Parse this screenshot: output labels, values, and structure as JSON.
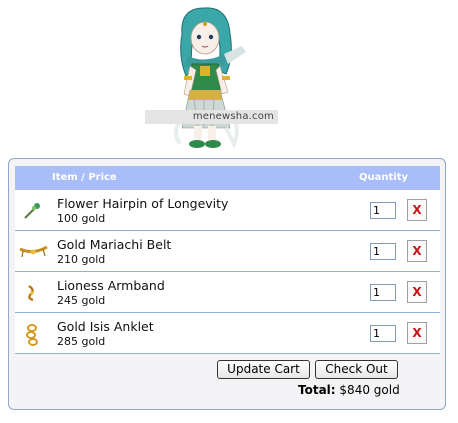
{
  "watermark": "menewsha.com",
  "cart": {
    "header": {
      "item_price": "Item / Price",
      "quantity": "Quantity"
    },
    "items": [
      {
        "name": "Flower Hairpin of Longevity",
        "price": "100 gold",
        "quantity": "1",
        "remove": "X",
        "icon": "flower-hairpin-icon"
      },
      {
        "name": "Gold Mariachi Belt",
        "price": "210 gold",
        "quantity": "1",
        "remove": "X",
        "icon": "belt-icon"
      },
      {
        "name": "Lioness Armband",
        "price": "245 gold",
        "quantity": "1",
        "remove": "X",
        "icon": "armband-icon"
      },
      {
        "name": "Gold Isis Anklet",
        "price": "285 gold",
        "quantity": "1",
        "remove": "X",
        "icon": "anklet-icon"
      }
    ],
    "update_label": "Update Cart",
    "checkout_label": "Check Out",
    "total_label": "Total:",
    "total_value": "$840 gold"
  },
  "colors": {
    "header_bg": "#a9bdf8",
    "remove_x": "#cc1111",
    "row_border": "#8fb0d8"
  }
}
